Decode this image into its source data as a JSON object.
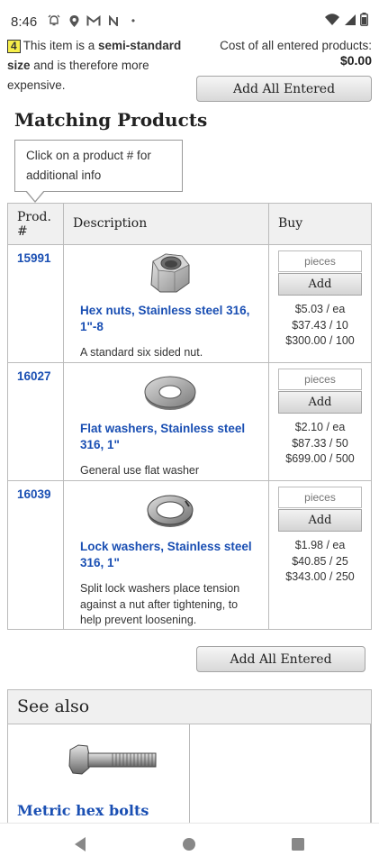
{
  "status_bar": {
    "time": "8:46",
    "dot": "•"
  },
  "note": {
    "number": "4",
    "text_before": "This item is a ",
    "bold": "semi-standard size",
    "text_after": " and is therefore more expensive."
  },
  "cost": {
    "label": "Cost of all entered products:",
    "value": "$0.00"
  },
  "add_all_label": "Add All Entered",
  "heading": "Matching Products",
  "tooltip": "Click on a product # for additional info",
  "table": {
    "headers": {
      "prod": "Prod. #",
      "description": "Description",
      "buy": "Buy"
    },
    "rows": [
      {
        "prod": "15991",
        "title": "Hex nuts, Stainless steel 316, 1\"-8",
        "desc": "A standard six sided nut.",
        "placeholder": "pieces",
        "add": "Add",
        "prices": [
          "$5.03 / ea",
          "$37.43 / 10",
          "$300.00 / 100"
        ],
        "icon": "hex-nut-icon"
      },
      {
        "prod": "16027",
        "title": "Flat washers, Stainless steel 316, 1\"",
        "desc": "General use flat washer",
        "placeholder": "pieces",
        "add": "Add",
        "prices": [
          "$2.10 / ea",
          "$87.33 / 50",
          "$699.00 / 500"
        ],
        "icon": "flat-washer-icon"
      },
      {
        "prod": "16039",
        "title": "Lock washers, Stainless steel 316, 1\"",
        "desc": "Split lock washers place tension against a nut after tightening, to help prevent loosening.",
        "placeholder": "pieces",
        "add": "Add",
        "prices": [
          "$1.98 / ea",
          "$40.85 / 25",
          "$343.00 / 250"
        ],
        "icon": "lock-washer-icon"
      }
    ]
  },
  "see_also": {
    "heading": "See also",
    "items": [
      {
        "label": "Metric hex bolts",
        "icon": "hex-bolt-icon"
      }
    ]
  },
  "colors": {
    "link": "#1a4fb3",
    "highlight": "#f6ef4a",
    "header_bg": "#f0f0f0"
  }
}
